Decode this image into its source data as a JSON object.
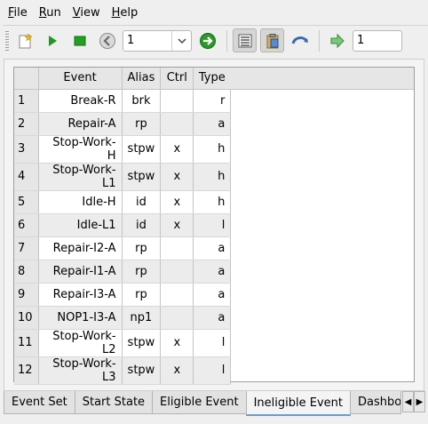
{
  "menu": [
    {
      "label": "File",
      "mnemonic": "F",
      "rest": "ile"
    },
    {
      "label": "Run",
      "mnemonic": "R",
      "rest": "un"
    },
    {
      "label": "View",
      "mnemonic": "V",
      "rest": "iew"
    },
    {
      "label": "Help",
      "mnemonic": "H",
      "rest": "elp"
    }
  ],
  "toolbar": {
    "step_value": "1",
    "step_value2": "1"
  },
  "table": {
    "headers": {
      "rownum": "",
      "event": "Event",
      "alias": "Alias",
      "ctrl": "Ctrl",
      "type": "Type"
    },
    "rows": [
      {
        "n": "1",
        "event": "Break-R",
        "alias": "brk",
        "ctrl": "",
        "type": "r"
      },
      {
        "n": "2",
        "event": "Repair-A",
        "alias": "rp",
        "ctrl": "",
        "type": "a"
      },
      {
        "n": "3",
        "event": "Stop-Work-H",
        "alias": "stpw",
        "ctrl": "x",
        "type": "h"
      },
      {
        "n": "4",
        "event": "Stop-Work-L1",
        "alias": "stpw",
        "ctrl": "x",
        "type": "h"
      },
      {
        "n": "5",
        "event": "Idle-H",
        "alias": "id",
        "ctrl": "x",
        "type": "h"
      },
      {
        "n": "6",
        "event": "Idle-L1",
        "alias": "id",
        "ctrl": "x",
        "type": "l"
      },
      {
        "n": "7",
        "event": "Repair-I2-A",
        "alias": "rp",
        "ctrl": "",
        "type": "a"
      },
      {
        "n": "8",
        "event": "Repair-I1-A",
        "alias": "rp",
        "ctrl": "",
        "type": "a"
      },
      {
        "n": "9",
        "event": "Repair-I3-A",
        "alias": "rp",
        "ctrl": "",
        "type": "a"
      },
      {
        "n": "10",
        "event": "NOP1-I3-A",
        "alias": "np1",
        "ctrl": "",
        "type": "a"
      },
      {
        "n": "11",
        "event": "Stop-Work-L2",
        "alias": "stpw",
        "ctrl": "x",
        "type": "l"
      },
      {
        "n": "12",
        "event": "Stop-Work-L3",
        "alias": "stpw",
        "ctrl": "x",
        "type": "l"
      }
    ]
  },
  "tabs": [
    {
      "label": "Event Set"
    },
    {
      "label": "Start State"
    },
    {
      "label": "Eligible Event"
    },
    {
      "label": "Ineligible Event",
      "active": true
    },
    {
      "label": "Dashboard"
    }
  ],
  "colors": {
    "accent": "#6b9bd0",
    "play": "#1e9a1e",
    "go": "#2a9a2a"
  }
}
